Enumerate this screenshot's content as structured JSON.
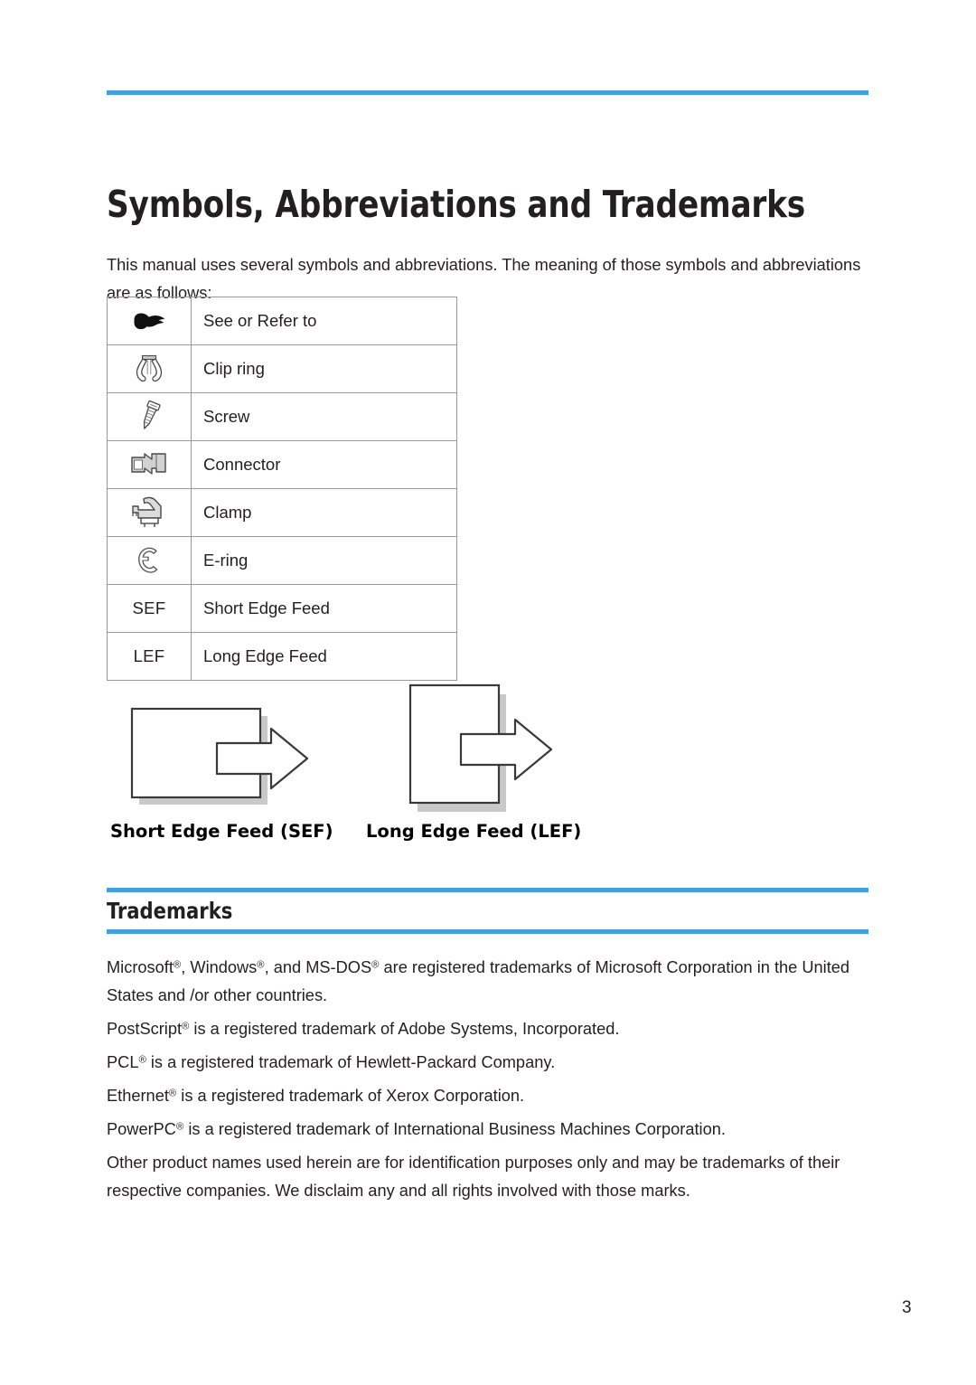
{
  "page": {
    "title": "Symbols, Abbreviations and Trademarks",
    "intro": "This manual uses several symbols and abbreviations. The meaning of those symbols and abbreviations are as follows:",
    "page_number": "3",
    "accent_color": "#43a0dd",
    "text_color": "#231f20"
  },
  "symbol_table": {
    "rows": [
      {
        "icon": "pointing-hand-icon",
        "abbr": "",
        "description": "See or Refer to"
      },
      {
        "icon": "clip-ring-icon",
        "abbr": "",
        "description": "Clip ring"
      },
      {
        "icon": "screw-icon",
        "abbr": "",
        "description": "Screw"
      },
      {
        "icon": "connector-icon",
        "abbr": "",
        "description": "Connector"
      },
      {
        "icon": "clamp-icon",
        "abbr": "",
        "description": "Clamp"
      },
      {
        "icon": "e-ring-icon",
        "abbr": "",
        "description": "E-ring"
      },
      {
        "icon": "",
        "abbr": "SEF",
        "description": "Short Edge Feed"
      },
      {
        "icon": "",
        "abbr": "LEF",
        "description": "Long Edge Feed"
      }
    ]
  },
  "feed_diagrams": {
    "sef": {
      "caption": "Short Edge Feed (SEF)",
      "icon": "short-edge-feed-diagram"
    },
    "lef": {
      "caption": "Long Edge Feed (LEF)",
      "icon": "long-edge-feed-diagram"
    }
  },
  "trademarks": {
    "heading": "Trademarks",
    "paragraphs": [
      "Microsoft®, Windows®, and MS-DOS® are registered trademarks of Microsoft Corporation in the United States and /or other countries.",
      "PostScript® is a registered trademark of Adobe Systems, Incorporated.",
      "PCL® is a registered trademark of Hewlett-Packard Company.",
      "Ethernet® is a registered trademark of Xerox Corporation.",
      "PowerPC® is a registered trademark of International Business Machines Corporation.",
      "Other product names used herein are for identification purposes only and may be trademarks of their respective companies. We disclaim any and all rights involved with those marks."
    ]
  }
}
